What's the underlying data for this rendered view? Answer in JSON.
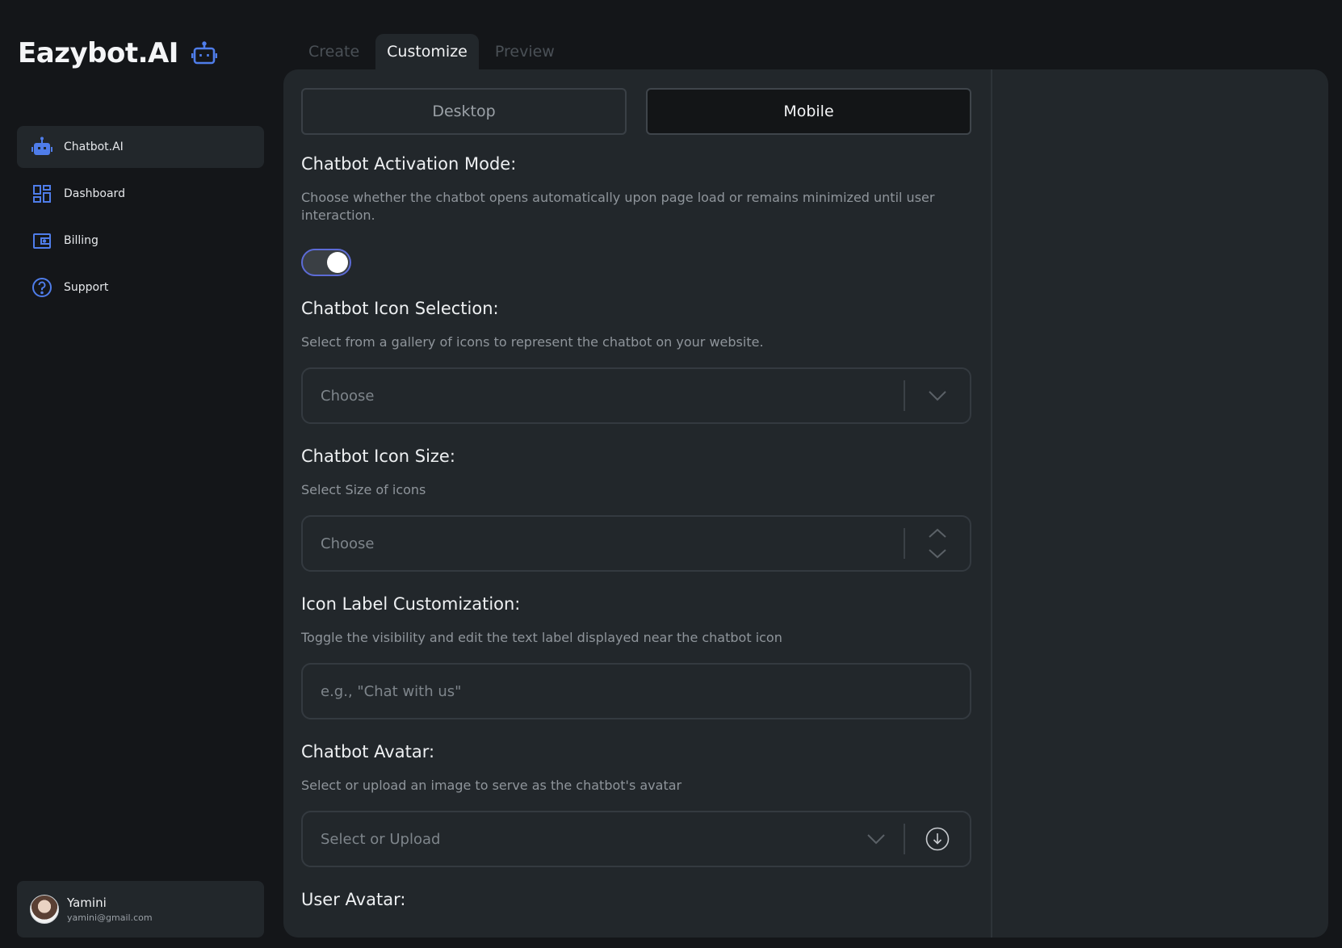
{
  "brand": {
    "name": "Eazybot.AI",
    "icon": "robot-icon",
    "accent": "#4f7dea"
  },
  "sidebar": {
    "items": [
      {
        "label": "Chatbot.AI",
        "icon": "robot-icon",
        "active": true
      },
      {
        "label": "Dashboard",
        "icon": "dashboard-icon",
        "active": false
      },
      {
        "label": "Billing",
        "icon": "wallet-icon",
        "active": false
      },
      {
        "label": "Support",
        "icon": "question-icon",
        "active": false
      }
    ]
  },
  "user": {
    "name": "Yamini",
    "email": "yamini@gmail.com"
  },
  "tabs": [
    {
      "label": "Create",
      "active": false
    },
    {
      "label": "Customize",
      "active": true
    },
    {
      "label": "Preview",
      "active": false
    }
  ],
  "device": {
    "desktop": "Desktop",
    "mobile": "Mobile",
    "selected": "Mobile"
  },
  "activation": {
    "title": "Chatbot Activation Mode:",
    "desc": "Choose whether the chatbot opens automatically upon page load or remains minimized until user interaction.",
    "toggle_on": true
  },
  "icon_selection": {
    "title": "Chatbot Icon Selection:",
    "desc": "Select from a gallery of icons to represent the chatbot on your website.",
    "value": "Choose"
  },
  "icon_size": {
    "title": "Chatbot Icon Size:",
    "desc": "Select Size of icons",
    "value": "Choose"
  },
  "label_custom": {
    "title": "Icon Label Customization:",
    "desc": "Toggle the visibility and edit the text label displayed near the chatbot icon",
    "placeholder": "e.g., \"Chat with us\""
  },
  "chatbot_avatar": {
    "title": "Chatbot Avatar:",
    "desc": "Select or upload an image to serve as the chatbot's avatar",
    "value": "Select or Upload"
  },
  "user_avatar": {
    "title": "User Avatar:"
  }
}
